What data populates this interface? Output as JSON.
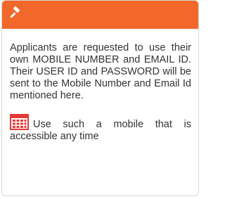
{
  "header": {
    "icon": "gavel-icon",
    "color": "#f2682a"
  },
  "info": {
    "paragraph": "Applicants are requested to use their own MOBILE NUMBER and EMAIL ID. Their USER ID and PASSWORD will be sent to the Mobile Number and Email Id mentioned here.",
    "note_icon": "calendar-icon",
    "note_icon_color": "#e53935",
    "note": "Use such a mobile that is accessible any time"
  }
}
